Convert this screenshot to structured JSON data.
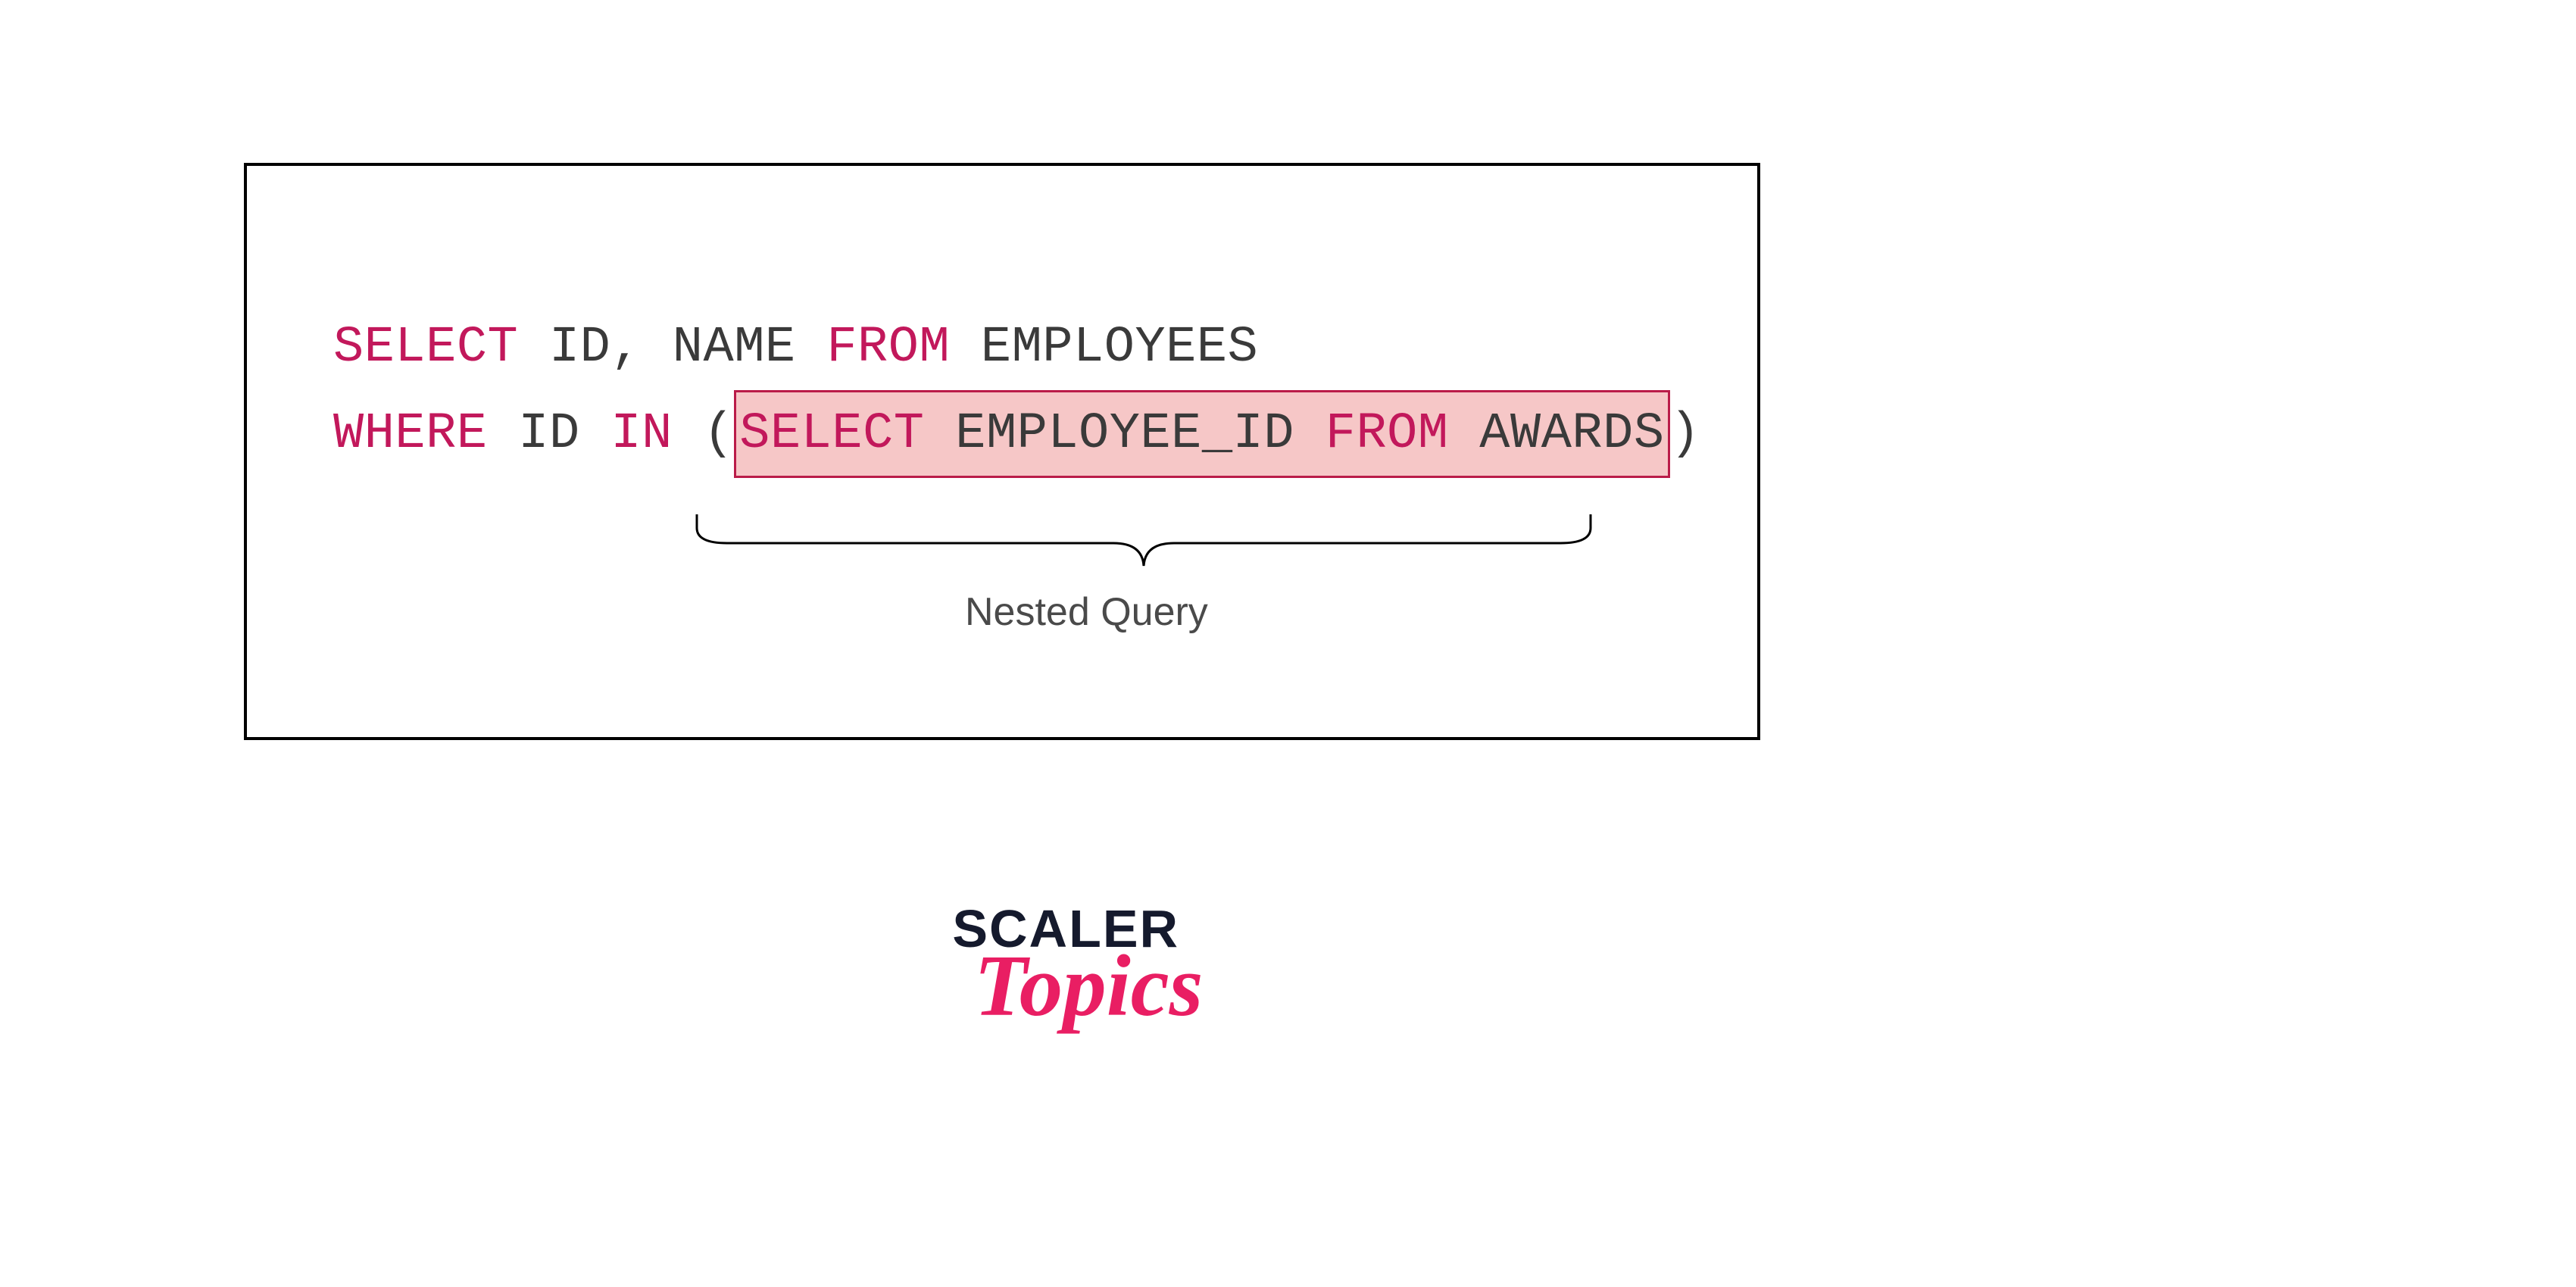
{
  "sql": {
    "line1": {
      "select": "SELECT",
      "cols": "ID, NAME",
      "from": "FROM",
      "table": "EMPLOYEES"
    },
    "line2": {
      "where": "WHERE",
      "col": "ID",
      "in": "IN",
      "open": "(",
      "inner_select": "SELECT",
      "inner_col": "EMPLOYEE_ID",
      "inner_from": "FROM",
      "inner_table": "AWARDS",
      "close": ")"
    }
  },
  "annotation": "Nested Query",
  "logo": {
    "line1": "SCALER",
    "line2": "Topics"
  },
  "colors": {
    "keyword": "#c2185b",
    "identifier": "#3a3a3a",
    "highlight_bg": "#f6c7c7",
    "highlight_border": "#ba1c49",
    "annotation": "#4a4a4a",
    "logo_dark": "#151a2d",
    "logo_pink": "#e91e63"
  }
}
